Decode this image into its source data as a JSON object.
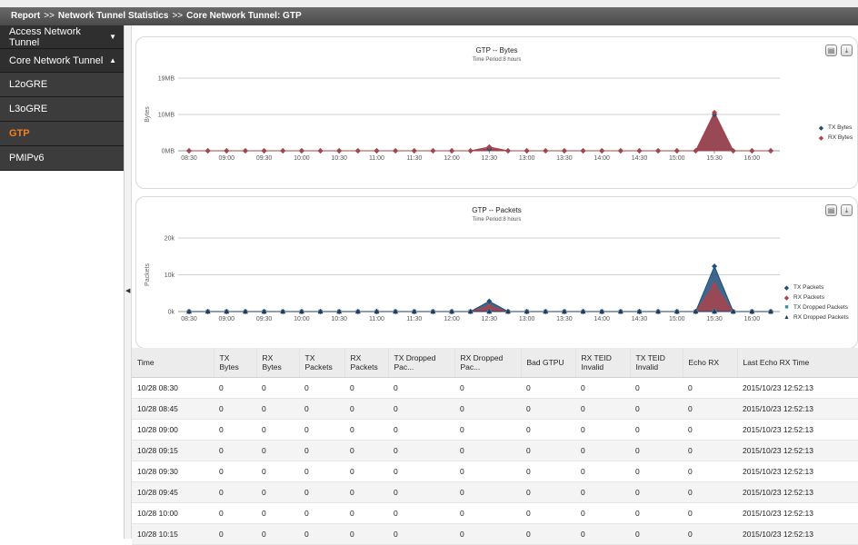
{
  "breadcrumb": {
    "items": [
      "Report",
      "Network Tunnel Statistics",
      "Core Network Tunnel: GTP"
    ],
    "separator": ">>"
  },
  "sidebar": {
    "groups": [
      {
        "label": "Access Network Tunnel",
        "caret": "▼"
      },
      {
        "label": "Core Network Tunnel",
        "caret": "▲"
      }
    ],
    "items": [
      {
        "label": "L2oGRE"
      },
      {
        "label": "L3oGRE"
      },
      {
        "label": "GTP",
        "active": true
      },
      {
        "label": "PMIPv6"
      }
    ]
  },
  "charts": {
    "bytes": {
      "title": "GTP -- Bytes",
      "subtitle": "Time Period:8 hours",
      "ylabel": "Bytes",
      "yticks": [
        "0MB",
        "10MB",
        "19MB"
      ],
      "legend": [
        {
          "name": "TX Bytes",
          "marker": "◆",
          "color": "#1f4e79"
        },
        {
          "name": "RX Bytes",
          "marker": "◆",
          "color": "#a9444c"
        }
      ]
    },
    "packets": {
      "title": "GTP -- Packets",
      "subtitle": "Time Period:8 hours",
      "ylabel": "Packets",
      "yticks": [
        "0k",
        "10k",
        "20k"
      ],
      "legend": [
        {
          "name": "TX Packets",
          "marker": "◆",
          "color": "#1f4e79"
        },
        {
          "name": "RX Packets",
          "marker": "◆",
          "color": "#a9444c"
        },
        {
          "name": "TX Dropped Packets",
          "marker": "■",
          "color": "#3d8a91"
        },
        {
          "name": "RX Dropped Packets",
          "marker": "▲",
          "color": "#1f3c66"
        }
      ]
    }
  },
  "chart_data": [
    {
      "type": "area",
      "title": "GTP -- Bytes",
      "subtitle": "Time Period:8 hours",
      "xlabel": "",
      "ylabel": "Bytes",
      "ylim": [
        0,
        19
      ],
      "x": [
        "08:30",
        "08:45",
        "09:00",
        "09:15",
        "09:30",
        "09:45",
        "10:00",
        "10:15",
        "10:30",
        "10:45",
        "11:00",
        "11:15",
        "11:30",
        "11:45",
        "12:00",
        "12:15",
        "12:30",
        "12:45",
        "13:00",
        "13:15",
        "13:30",
        "13:45",
        "14:00",
        "14:15",
        "14:30",
        "14:45",
        "15:00",
        "15:15",
        "15:30",
        "15:45",
        "16:00",
        "16:15"
      ],
      "xticks": [
        "08:30",
        "09:00",
        "09:30",
        "10:00",
        "10:30",
        "11:00",
        "11:30",
        "12:00",
        "12:30",
        "13:00",
        "13:30",
        "14:00",
        "14:30",
        "15:00",
        "15:30",
        "16:00"
      ],
      "series": [
        {
          "name": "TX Bytes",
          "color": "#1f4e79",
          "values": [
            0,
            0,
            0,
            0,
            0,
            0,
            0,
            0,
            0,
            0,
            0,
            0,
            0,
            0,
            0,
            0,
            0.5,
            0,
            0,
            0,
            0,
            0,
            0,
            0,
            0,
            0,
            0,
            0,
            9.5,
            0,
            0,
            0
          ]
        },
        {
          "name": "RX Bytes",
          "color": "#a9444c",
          "values": [
            0,
            0,
            0,
            0,
            0,
            0,
            0,
            0,
            0,
            0,
            0,
            0,
            0,
            0,
            0,
            0,
            1,
            0,
            0,
            0,
            0,
            0,
            0,
            0,
            0,
            0,
            0,
            0,
            10,
            0,
            0,
            0
          ]
        }
      ],
      "legend": "right"
    },
    {
      "type": "area",
      "title": "GTP -- Packets",
      "subtitle": "Time Period:8 hours",
      "xlabel": "",
      "ylabel": "Packets",
      "ylim": [
        0,
        20000
      ],
      "x": [
        "08:30",
        "08:45",
        "09:00",
        "09:15",
        "09:30",
        "09:45",
        "10:00",
        "10:15",
        "10:30",
        "10:45",
        "11:00",
        "11:15",
        "11:30",
        "11:45",
        "12:00",
        "12:15",
        "12:30",
        "12:45",
        "13:00",
        "13:15",
        "13:30",
        "13:45",
        "14:00",
        "14:15",
        "14:30",
        "14:45",
        "15:00",
        "15:15",
        "15:30",
        "15:45",
        "16:00",
        "16:15"
      ],
      "xticks": [
        "08:30",
        "09:00",
        "09:30",
        "10:00",
        "10:30",
        "11:00",
        "11:30",
        "12:00",
        "12:30",
        "13:00",
        "13:30",
        "14:00",
        "14:30",
        "15:00",
        "15:30",
        "16:00"
      ],
      "series": [
        {
          "name": "TX Packets",
          "color": "#1f4e79",
          "values": [
            0,
            0,
            0,
            0,
            0,
            0,
            0,
            0,
            0,
            0,
            0,
            0,
            0,
            0,
            0,
            0,
            2800,
            0,
            0,
            0,
            0,
            0,
            0,
            0,
            0,
            0,
            0,
            0,
            12300,
            0,
            0,
            0
          ]
        },
        {
          "name": "RX Packets",
          "color": "#a9444c",
          "values": [
            0,
            0,
            0,
            0,
            0,
            0,
            0,
            0,
            0,
            0,
            0,
            0,
            0,
            0,
            0,
            0,
            1500,
            0,
            0,
            0,
            0,
            0,
            0,
            0,
            0,
            0,
            0,
            0,
            7300,
            0,
            0,
            0
          ]
        },
        {
          "name": "TX Dropped Packets",
          "color": "#3d8a91",
          "values": [
            0,
            0,
            0,
            0,
            0,
            0,
            0,
            0,
            0,
            0,
            0,
            0,
            0,
            0,
            0,
            0,
            0,
            0,
            0,
            0,
            0,
            0,
            0,
            0,
            0,
            0,
            0,
            0,
            0,
            0,
            0,
            0
          ]
        },
        {
          "name": "RX Dropped Packets",
          "color": "#1f3c66",
          "values": [
            0,
            0,
            0,
            0,
            0,
            0,
            0,
            0,
            0,
            0,
            0,
            0,
            0,
            0,
            0,
            0,
            0,
            0,
            0,
            0,
            0,
            0,
            0,
            0,
            0,
            0,
            0,
            0,
            0,
            0,
            0,
            0
          ]
        }
      ],
      "legend": "right"
    }
  ],
  "table": {
    "columns": [
      "Time",
      "TX Bytes",
      "RX Bytes",
      "TX Packets",
      "RX Packets",
      "TX Dropped Pac...",
      "RX Dropped Pac...",
      "Bad GTPU",
      "RX TEID\nInvalid",
      "TX TEID\nInvalid",
      "Echo RX",
      "Last Echo RX Time"
    ],
    "rows": [
      [
        "10/28 08:30",
        "0",
        "0",
        "0",
        "0",
        "0",
        "0",
        "0",
        "0",
        "0",
        "0",
        "2015/10/23 12:52:13"
      ],
      [
        "10/28 08:45",
        "0",
        "0",
        "0",
        "0",
        "0",
        "0",
        "0",
        "0",
        "0",
        "0",
        "2015/10/23 12:52:13"
      ],
      [
        "10/28 09:00",
        "0",
        "0",
        "0",
        "0",
        "0",
        "0",
        "0",
        "0",
        "0",
        "0",
        "2015/10/23 12:52:13"
      ],
      [
        "10/28 09:15",
        "0",
        "0",
        "0",
        "0",
        "0",
        "0",
        "0",
        "0",
        "0",
        "0",
        "2015/10/23 12:52:13"
      ],
      [
        "10/28 09:30",
        "0",
        "0",
        "0",
        "0",
        "0",
        "0",
        "0",
        "0",
        "0",
        "0",
        "2015/10/23 12:52:13"
      ],
      [
        "10/28 09:45",
        "0",
        "0",
        "0",
        "0",
        "0",
        "0",
        "0",
        "0",
        "0",
        "0",
        "2015/10/23 12:52:13"
      ],
      [
        "10/28 10:00",
        "0",
        "0",
        "0",
        "0",
        "0",
        "0",
        "0",
        "0",
        "0",
        "0",
        "2015/10/23 12:52:13"
      ],
      [
        "10/28 10:15",
        "0",
        "0",
        "0",
        "0",
        "0",
        "0",
        "0",
        "0",
        "0",
        "0",
        "2015/10/23 12:52:13"
      ]
    ]
  }
}
